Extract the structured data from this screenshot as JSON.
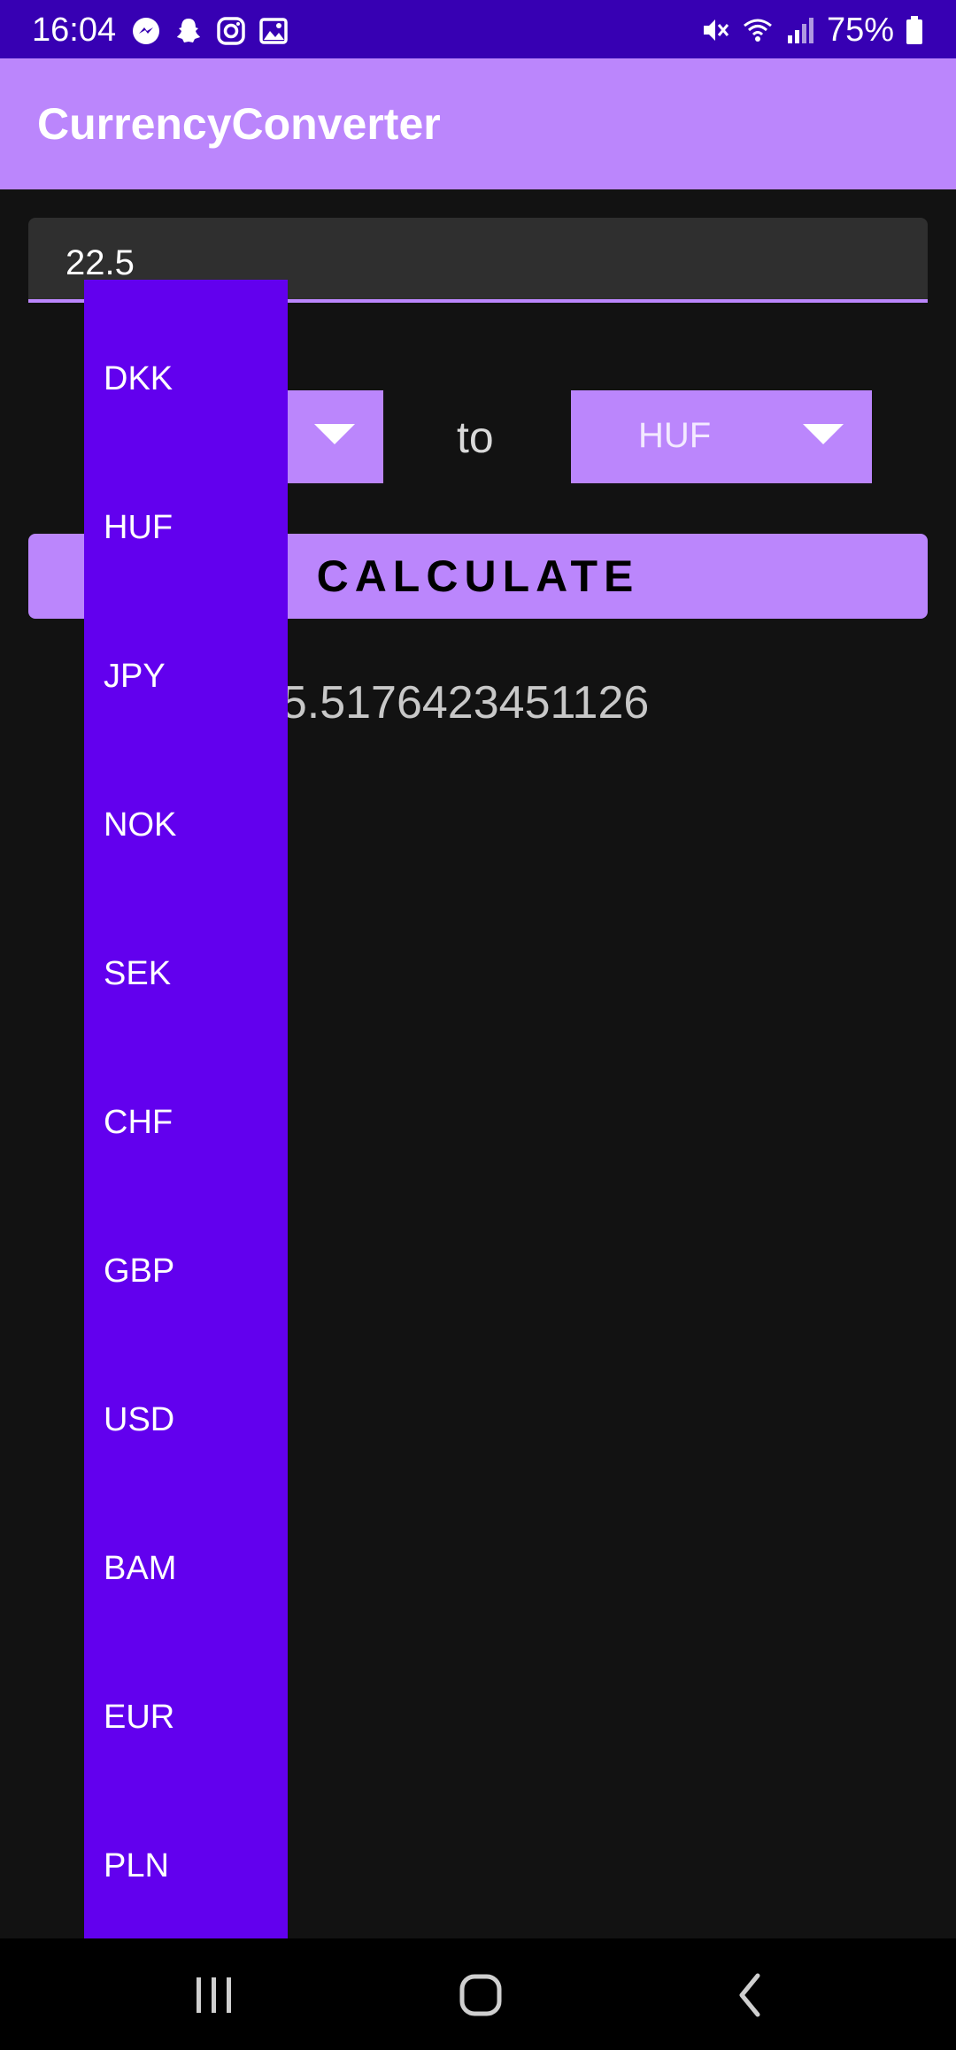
{
  "status_bar": {
    "time": "16:04",
    "battery": "75%"
  },
  "app_bar": {
    "title": "CurrencyConverter"
  },
  "amount": {
    "value": "22.5"
  },
  "spinners": {
    "to_label": "to",
    "to_value": "HUF"
  },
  "calculate": {
    "label": "CALCULATE"
  },
  "result": {
    "value": "105.5176423451126"
  },
  "dropdown": {
    "items": [
      "DKK",
      "HUF",
      "JPY",
      "NOK",
      "SEK",
      "CHF",
      "GBP",
      "USD",
      "BAM",
      "EUR",
      "PLN"
    ]
  },
  "colors": {
    "status_bar": "#3700B3",
    "primary": "#BB86FC",
    "dropdown": "#6200EE",
    "background": "#121212"
  }
}
